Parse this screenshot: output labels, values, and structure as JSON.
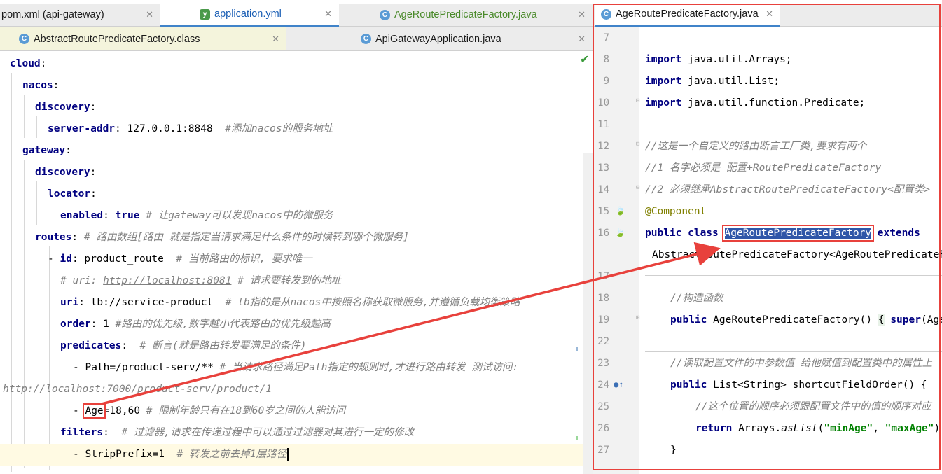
{
  "left_tabs_row1": [
    {
      "label": "pom.xml (api-gateway)",
      "icon": "none"
    },
    {
      "label": "application.yml",
      "icon": "yml-file-icon"
    },
    {
      "label": "AgeRoutePredicateFactory.java",
      "icon": "class-file-icon"
    }
  ],
  "left_tabs_row2": [
    {
      "label": "AbstractRoutePredicateFactory.class",
      "icon": "class-file-icon"
    },
    {
      "label": "ApiGatewayApplication.java",
      "icon": "class-file-icon"
    }
  ],
  "right_tab": {
    "label": "AgeRoutePredicateFactory.java"
  },
  "close_glyph": "✕",
  "yaml": {
    "l1": "cloud",
    "l2": "nacos",
    "l3": "discovery",
    "l4_key": "server-addr",
    "l4_val": "127.0.0.1:8848",
    "l4_comment": "#添加nacos的服务地址",
    "l5": "gateway",
    "l6": "discovery",
    "l7": "locator",
    "l8_key": "enabled",
    "l8_val": "true",
    "l8_comment": "# 让gateway可以发现nacos中的微服务",
    "l9_key": "routes",
    "l9_comment": "# 路由数组[路由 就是指定当请求满足什么条件的时候转到哪个微服务]",
    "l10_key": "id",
    "l10_val": "product_route",
    "l10_comment": "# 当前路由的标识, 要求唯一",
    "l11_comment_a": "# uri: ",
    "l11_url": "http://localhost:8081",
    "l11_comment_b": " # 请求要转发到的地址",
    "l12_key": "uri",
    "l12_val": "lb://service-product",
    "l12_comment": "#  lb指的是从nacos中按照名称获取微服务,并遵循负载均衡策略",
    "l13_key": "order",
    "l13_val": "1",
    "l13_comment": "#路由的优先级,数字越小代表路由的优先级越高",
    "l14_key": "predicates",
    "l14_comment": "# 断言(就是路由转发要满足的条件)",
    "l15_val": "Path=/product-serv/**",
    "l15_comment": "# 当请求路径满足Path指定的规则时,才进行路由转发 测试访问:",
    "l16_url": "http://localhost:7000/product-serv/product/1",
    "l17_age": "Age",
    "l17_val": "=18,60",
    "l17_comment": "# 限制年龄只有在18到60岁之间的人能访问",
    "l18_key": "filters",
    "l18_comment": "# 过滤器,请求在传递过程中可以通过过滤器对其进行一定的修改",
    "l19_val": "StripPrefix=1",
    "l19_comment": "# 转发之前去掉1层路径"
  },
  "java": {
    "line_numbers": [
      "7",
      "8",
      "9",
      "10",
      "11",
      "12",
      "13",
      "14",
      "15",
      "16",
      "",
      "17",
      "18",
      "19",
      "22",
      "23",
      "24",
      "25",
      "26",
      "27"
    ],
    "import_kw": "import",
    "imp1": "java.util.Arrays;",
    "imp2": "java.util.List;",
    "imp3": "java.util.function.Predicate;",
    "c1": "//这是一个自定义的路由断言工厂类,要求有两个",
    "c2": "//1 名字必须是 配置+RoutePredicateFactory",
    "c3": "//2 必须继承AbstractRoutePredicateFactory<配置类>",
    "annotation": "@Component",
    "public_class": "public class",
    "classname": "AgeRoutePredicateFactory",
    "extends": "extends",
    "extends_line": "AbstractRoutePredicateFactory<AgeRoutePredicateFactory.Config>",
    "c4": "//构造函数",
    "ctor_public": "public",
    "ctor_rest": "AgeRoutePredicateFactory()",
    "ctor_body_brace": "{",
    "ctor_super": "super",
    "ctor_tail": "(AgeRoutePredicateFactory.Config.class); }",
    "c5": "//读取配置文件的中参数值 给他赋值到配置类中的属性上",
    "m_public": "public",
    "m_sig": "List<String> shortcutFieldOrder() {",
    "c6": "//这个位置的顺序必须跟配置文件中的值的顺序对应",
    "ret_kw": "return",
    "ret_a": "Arrays.",
    "ret_method": "asList",
    "ret_open": "(",
    "s1": "\"minAge\"",
    "ret_comma": ", ",
    "s2": "\"maxAge\"",
    "ret_close": ");",
    "close_brace": "}"
  },
  "colors": {
    "accent_red": "#e8413c",
    "selection": "#2f56a8"
  }
}
